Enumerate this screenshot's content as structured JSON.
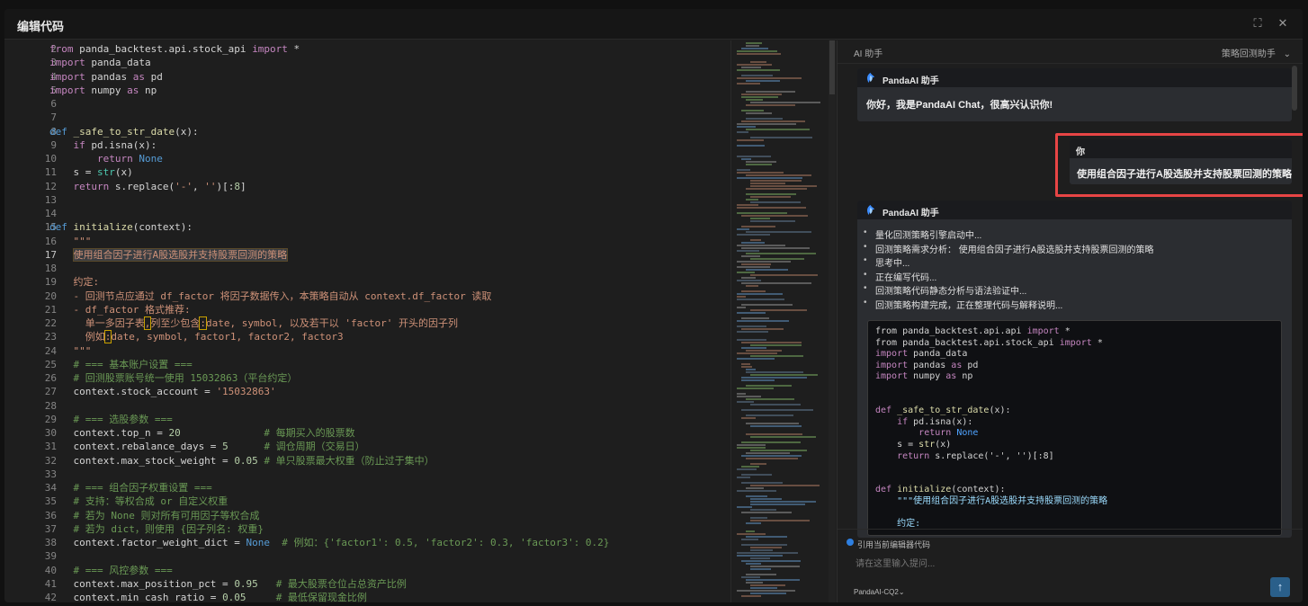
{
  "window": {
    "title": "编辑代码",
    "fullscreen_icon": "⛶",
    "close_icon": "✕"
  },
  "editor": {
    "active_line": 17,
    "lines": [
      {
        "n": 2,
        "html": "<span class=\"kw2\">from</span> panda_backtest.api.stock_api <span class=\"kw2\">import</span> *"
      },
      {
        "n": 3,
        "html": "<span class=\"kw2\">import</span> panda_data"
      },
      {
        "n": 4,
        "html": "<span class=\"kw2\">import</span> pandas <span class=\"kw2\">as</span> pd"
      },
      {
        "n": 5,
        "html": "<span class=\"kw2\">import</span> numpy <span class=\"kw2\">as</span> np"
      },
      {
        "n": 6,
        "html": ""
      },
      {
        "n": 7,
        "html": ""
      },
      {
        "n": 8,
        "html": "<span class=\"kw\">def</span> <span class=\"fn\">_safe_to_str_date</span>(x):"
      },
      {
        "n": 9,
        "html": "    <span class=\"kw2\">if</span> pd.isna(x):"
      },
      {
        "n": 10,
        "html": "        <span class=\"kw2\">return</span> <span class=\"kw\">None</span>"
      },
      {
        "n": 11,
        "html": "    s = <span class=\"bi\">str</span>(x)"
      },
      {
        "n": 12,
        "html": "    <span class=\"kw2\">return</span> s.replace(<span class=\"str\">'-'</span>, <span class=\"str\">''</span>)[:<span class=\"num\">8</span>]"
      },
      {
        "n": 13,
        "html": ""
      },
      {
        "n": 14,
        "html": ""
      },
      {
        "n": 15,
        "html": "<span class=\"kw\">def</span> <span class=\"fn\">initialize</span>(context):"
      },
      {
        "n": 16,
        "html": "    <span class=\"doc\">\"\"\"</span>"
      },
      {
        "n": 17,
        "html": "    <span class=\"doc hl\">使用组合因子进行A股选股并支持股票回测的策略</span>"
      },
      {
        "n": 18,
        "html": ""
      },
      {
        "n": 19,
        "html": "    <span class=\"doc\">约定:</span>"
      },
      {
        "n": 20,
        "html": "    <span class=\"doc\">- 回测节点应通过 df_factor 将因子数据传入，本策略自动从 context.df_factor 读取</span>"
      },
      {
        "n": 21,
        "html": "    <span class=\"doc\">- df_factor 格式推荐:</span>"
      },
      {
        "n": 22,
        "html": "      <span class=\"doc\">单一多因子表<span class=\"hlbox\">,</span>列至少包含<span class=\"hlbox\">:</span>date, symbol, 以及若干以 'factor' 开头的因子列</span>"
      },
      {
        "n": 23,
        "html": "      <span class=\"doc\">例如<span class=\"hlbox\">:</span>date, symbol, factor1, factor2, factor3</span>"
      },
      {
        "n": 24,
        "html": "    <span class=\"doc\">\"\"\"</span>"
      },
      {
        "n": 25,
        "html": "    <span class=\"cm\"># === 基本账户设置 ===</span>"
      },
      {
        "n": 26,
        "html": "    <span class=\"cm\"># 回测股票账号统一使用 15032863（平台约定）</span>"
      },
      {
        "n": 27,
        "html": "    context.stock_account = <span class=\"str\">'15032863'</span>"
      },
      {
        "n": 28,
        "html": ""
      },
      {
        "n": 29,
        "html": "    <span class=\"cm\"># === 选股参数 ===</span>"
      },
      {
        "n": 30,
        "html": "    context.top_n = <span class=\"num\">20</span>              <span class=\"cm\"># 每期买入的股票数</span>"
      },
      {
        "n": 31,
        "html": "    context.rebalance_days = <span class=\"num\">5</span>      <span class=\"cm\"># 调仓周期（交易日）</span>"
      },
      {
        "n": 32,
        "html": "    context.max_stock_weight = <span class=\"num\">0.05</span> <span class=\"cm\"># 单只股票最大权重（防止过于集中）</span>"
      },
      {
        "n": 33,
        "html": ""
      },
      {
        "n": 34,
        "html": "    <span class=\"cm\"># === 组合因子权重设置 ===</span>"
      },
      {
        "n": 35,
        "html": "    <span class=\"cm\"># 支持：等权合成 or 自定义权重</span>"
      },
      {
        "n": 36,
        "html": "    <span class=\"cm\"># 若为 None 则对所有可用因子等权合成</span>"
      },
      {
        "n": 37,
        "html": "    <span class=\"cm\"># 若为 dict，则使用 {因子列名: 权重}</span>"
      },
      {
        "n": 38,
        "html": "    context.factor_weight_dict = <span class=\"kw\">None</span>  <span class=\"cm\"># 例如：{'factor1': 0.5, 'factor2': 0.3, 'factor3': 0.2}</span>"
      },
      {
        "n": 39,
        "html": ""
      },
      {
        "n": 40,
        "html": "    <span class=\"cm\"># === 风控参数 ===</span>"
      },
      {
        "n": 41,
        "html": "    context.max_position_pct = <span class=\"num\">0.95</span>   <span class=\"cm\"># 最大股票仓位占总资产比例</span>"
      },
      {
        "n": 42,
        "html": "    context.min_cash_ratio = <span class=\"num\">0.05</span>     <span class=\"cm\"># 最低保留现金比例</span>"
      }
    ]
  },
  "ai": {
    "header_label": "AI 助手",
    "mode_label": "策略回测助手",
    "mode_caret": "⌄",
    "assistant_name": "PandaAI 助手",
    "greeting": "你好，我是PandaAI Chat，很高兴认识你!",
    "user_name": "你",
    "user_message": "使用组合因子进行A股选股并支持股票回测的策略",
    "assistant_name_2": "PandaAI 助手",
    "steps": [
      "量化回测策略引擎启动中...",
      "回测策略需求分析：  使用组合因子进行A股选股并支持股票回测的策略",
      "思考中...",
      "正在编写代码...",
      "回测策略代码静态分析与语法验证中...",
      "回测策略构建完成，正在整理代码与解释说明..."
    ],
    "code": [
      {
        "html": "from panda_backtest.api.api <span class=\"kw\">import</span> *"
      },
      {
        "html": "from panda_backtest.api.stock_api <span class=\"kw\">import</span> *"
      },
      {
        "html": "<span class=\"kw\">import</span> panda_data"
      },
      {
        "html": "<span class=\"kw\">import</span> pandas <span class=\"kw\">as</span> pd"
      },
      {
        "html": "<span class=\"kw\">import</span> numpy <span class=\"kw\">as</span> np"
      },
      {
        "html": ""
      },
      {
        "html": ""
      },
      {
        "html": "<span class=\"kw\">def</span> <span class=\"fnn\">_safe_to_str_date</span>(x):"
      },
      {
        "html": "    <span class=\"kw\">if</span> pd.isna(x):"
      },
      {
        "html": "        <span class=\"kw\">return</span> <span class=\"kwd\">None</span>"
      },
      {
        "html": "    s = <span class=\"fnn\">str</span>(x)"
      },
      {
        "html": "    <span class=\"kw\">return</span> s.replace('-', '')[:8]"
      },
      {
        "html": ""
      },
      {
        "html": ""
      },
      {
        "html": "<span class=\"kw\">def</span> <span class=\"fnn\">initialize</span>(context):"
      },
      {
        "html": "    <span class=\"doc2\">\"\"\"使用组合因子进行A股选股并支持股票回测的策略</span>"
      },
      {
        "html": ""
      },
      {
        "html": "    <span class=\"doc2\">约定:</span>"
      }
    ],
    "quote_label": "引用当前编辑器代码",
    "input_value": "",
    "input_placeholder": "请在这里输入提问...",
    "model_label": "PandaAI-CQ2",
    "model_caret": "⌄",
    "send_icon": "↑"
  },
  "colors": {
    "accent": "#2e7fe0",
    "highlight_border": "#e84545"
  }
}
